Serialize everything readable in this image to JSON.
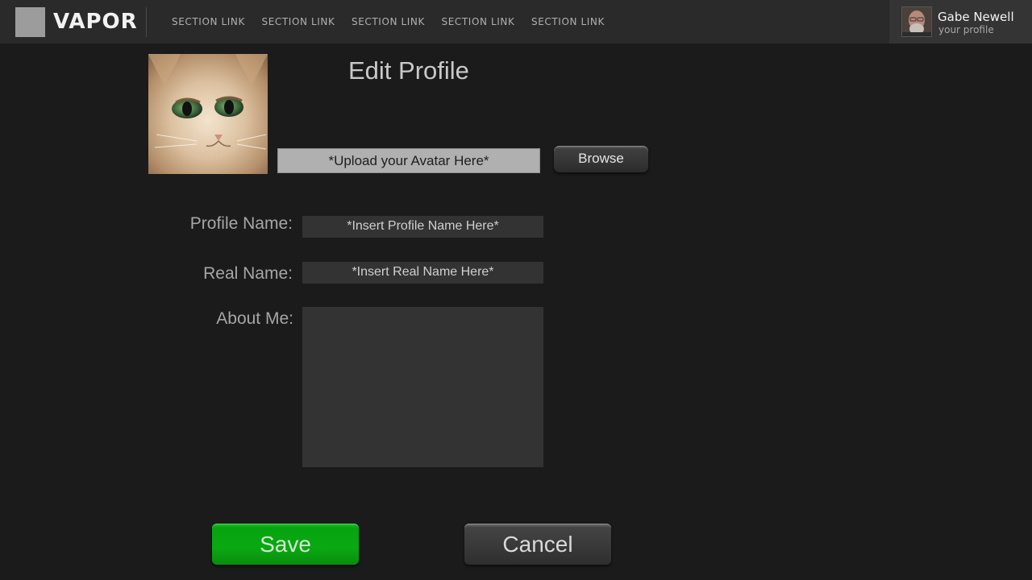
{
  "header": {
    "brand": "VAPOR",
    "nav": [
      {
        "label": "SECTION LINK"
      },
      {
        "label": "SECTION LINK"
      },
      {
        "label": "SECTION LINK"
      },
      {
        "label": "SECTION LINK"
      },
      {
        "label": "SECTION LINK"
      }
    ],
    "user": {
      "name": "Gabe Newell",
      "subtitle": "your profile"
    }
  },
  "page": {
    "title": "Edit Profile",
    "avatar_upload": {
      "placeholder": "*Upload your Avatar Here*",
      "browse_label": "Browse"
    },
    "fields": {
      "profile_name": {
        "label": "Profile Name:",
        "placeholder": "*Insert Profile Name Here*"
      },
      "real_name": {
        "label": "Real Name:",
        "placeholder": "*Insert Real Name Here*"
      },
      "about_me": {
        "label": "About Me:",
        "value": ""
      }
    },
    "actions": {
      "save_label": "Save",
      "cancel_label": "Cancel"
    }
  },
  "colors": {
    "background": "#1b1b1c",
    "topbar": "#2a2a2b",
    "save_green": "#0aa812",
    "field_bg": "#333334"
  },
  "icons": {
    "logo": "square-logo-icon",
    "avatar": "cat-avatar-image",
    "user_avatar": "user-avatar-photo"
  }
}
